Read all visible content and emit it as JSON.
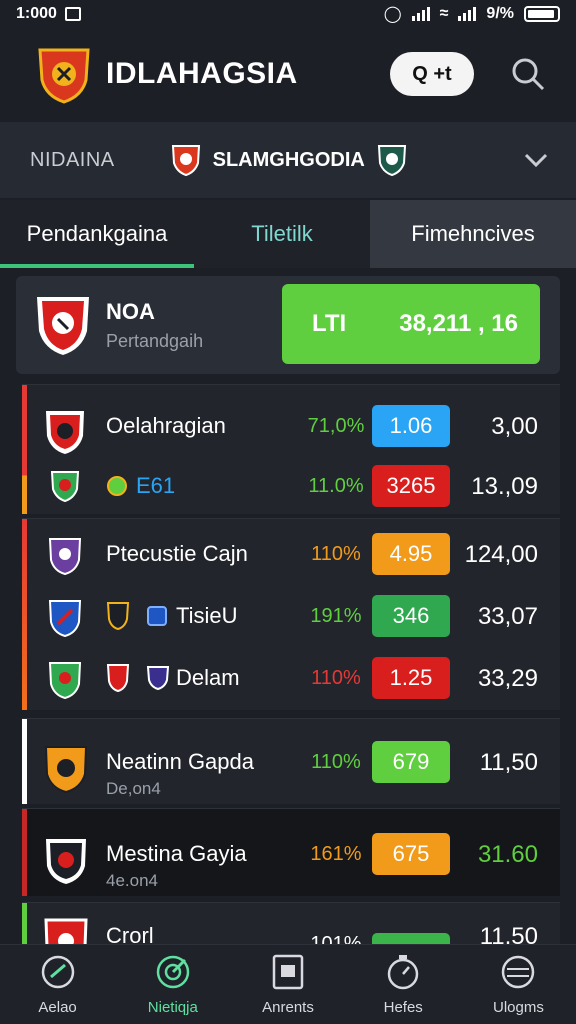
{
  "status": {
    "time": "1:000",
    "battery": "9/%"
  },
  "header": {
    "title": "IDLAHAGSIA",
    "pill": "Q +t"
  },
  "league": {
    "left": "NIDAINA",
    "center": "SLAMGHGODIA"
  },
  "tabs": [
    "Pendankgaina",
    "Tiletilk",
    "Fimehncives"
  ],
  "featured": {
    "name": "NOA",
    "sub": "Pertandgaih",
    "label": "LTI",
    "value": "38,211 , 16"
  },
  "groups": [
    {
      "color": "#e53935",
      "rows": [
        {
          "name": "Oelahragian",
          "pct": "71,0%",
          "odd": "1.06",
          "val": "3,00",
          "pct_color": "#5fcf3f",
          "odd_bg": "#2aa4f4",
          "val_color": "#ffffff"
        },
        {
          "name": "E61",
          "pct": "11.0%",
          "odd": "3265",
          "val": "13.,09",
          "pct_color": "#5fcf3f",
          "odd_bg": "#d91e1e",
          "val_color": "#ffffff"
        }
      ]
    },
    {
      "color": "#e54b2b",
      "rows": [
        {
          "name": "Ptecustie Cajn",
          "pct": "110%",
          "odd": "4.95",
          "val": "124,00",
          "pct_color": "#f29b1a",
          "odd_bg": "#f29b1a",
          "val_color": "#ffffff"
        },
        {
          "name": "TisieU",
          "pct": "191%",
          "odd": "346",
          "val": "33,07",
          "pct_color": "#5fcf3f",
          "odd_bg": "#2fa84f",
          "val_color": "#ffffff"
        },
        {
          "name": "Delam",
          "pct": "110%",
          "odd": "1.25",
          "val": "33,29",
          "pct_color": "#e53935",
          "odd_bg": "#d91e1e",
          "val_color": "#ffffff"
        }
      ]
    },
    {
      "color": "#ffffff",
      "rows": [
        {
          "name": "Neatinn Gapda",
          "sub": "De,on4",
          "pct": "110%",
          "odd": "679",
          "val": "11,50",
          "pct_color": "#5fcf3f",
          "odd_bg": "#5fcf3f",
          "val_color": "#ffffff"
        }
      ]
    },
    {
      "color": "#c62828",
      "rows": [
        {
          "name": "Mestina Gayia",
          "sub": "4e.on4",
          "pct": "161%",
          "odd": "675",
          "val": "31.60",
          "pct_color": "#f29b1a",
          "odd_bg": "#f29b1a",
          "val_color": "#5fcf3f"
        }
      ]
    },
    {
      "color": "#5fcf3f",
      "rows": [
        {
          "name": "Crorl",
          "pct": "101%",
          "odd": "",
          "val": "11,50",
          "pct_color": "#5fcf3f",
          "odd_bg": "#3bb54a",
          "val_color": "#ffffff"
        }
      ]
    }
  ],
  "nav": [
    {
      "label": "Aelao",
      "icon": "whistle-icon",
      "active": false
    },
    {
      "label": "Nietiqja",
      "icon": "target-icon",
      "active": true
    },
    {
      "label": "Anrents",
      "icon": "card-icon",
      "active": false
    },
    {
      "label": "Hefes",
      "icon": "stopwatch-icon",
      "active": false
    },
    {
      "label": "Ulogms",
      "icon": "ball-icon",
      "active": false
    }
  ]
}
